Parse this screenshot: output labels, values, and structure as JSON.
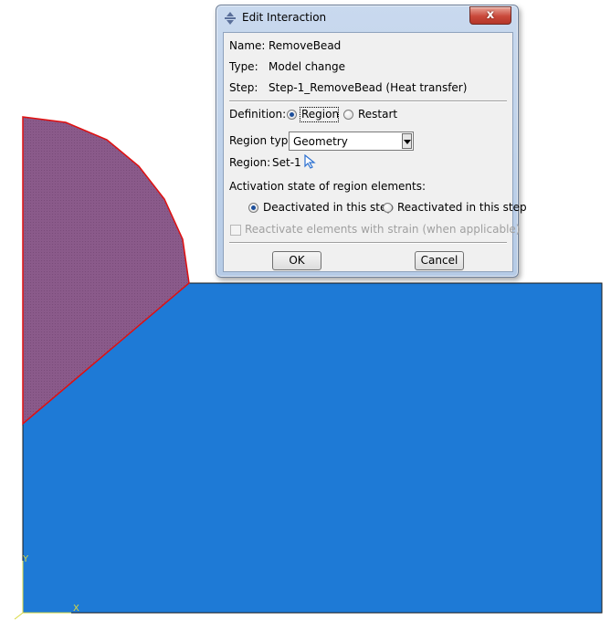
{
  "viewport": {
    "axis_x_label": "X",
    "axis_y_label": "Y",
    "colors": {
      "part": "#1e7ad6",
      "bead": "#8a5a8a",
      "bead_edge": "#e01010",
      "outline": "#1a1a1a",
      "triad": "#d8d840"
    }
  },
  "dialog": {
    "title": "Edit Interaction",
    "close_symbol": "x",
    "name_label": "Name:",
    "name_value": "RemoveBead",
    "type_label": "Type:",
    "type_value": "Model change",
    "step_label": "Step:",
    "step_value": "Step-1_RemoveBead (Heat transfer)",
    "definition_label": "Definition:",
    "definition_options": [
      "Region",
      "Restart"
    ],
    "definition_selected": "Region",
    "region_type_label": "Region type:",
    "region_type_value": "Geometry",
    "region_label": "Region:",
    "region_value": "Set-1",
    "activation_label": "Activation state of region elements:",
    "activation_options": [
      "Deactivated in this step",
      "Reactivated in this step"
    ],
    "activation_selected": "Deactivated in this step",
    "strain_checkbox_label": "Reactivate elements with strain (when applicable)",
    "strain_checked": false,
    "ok_label": "OK",
    "cancel_label": "Cancel"
  }
}
